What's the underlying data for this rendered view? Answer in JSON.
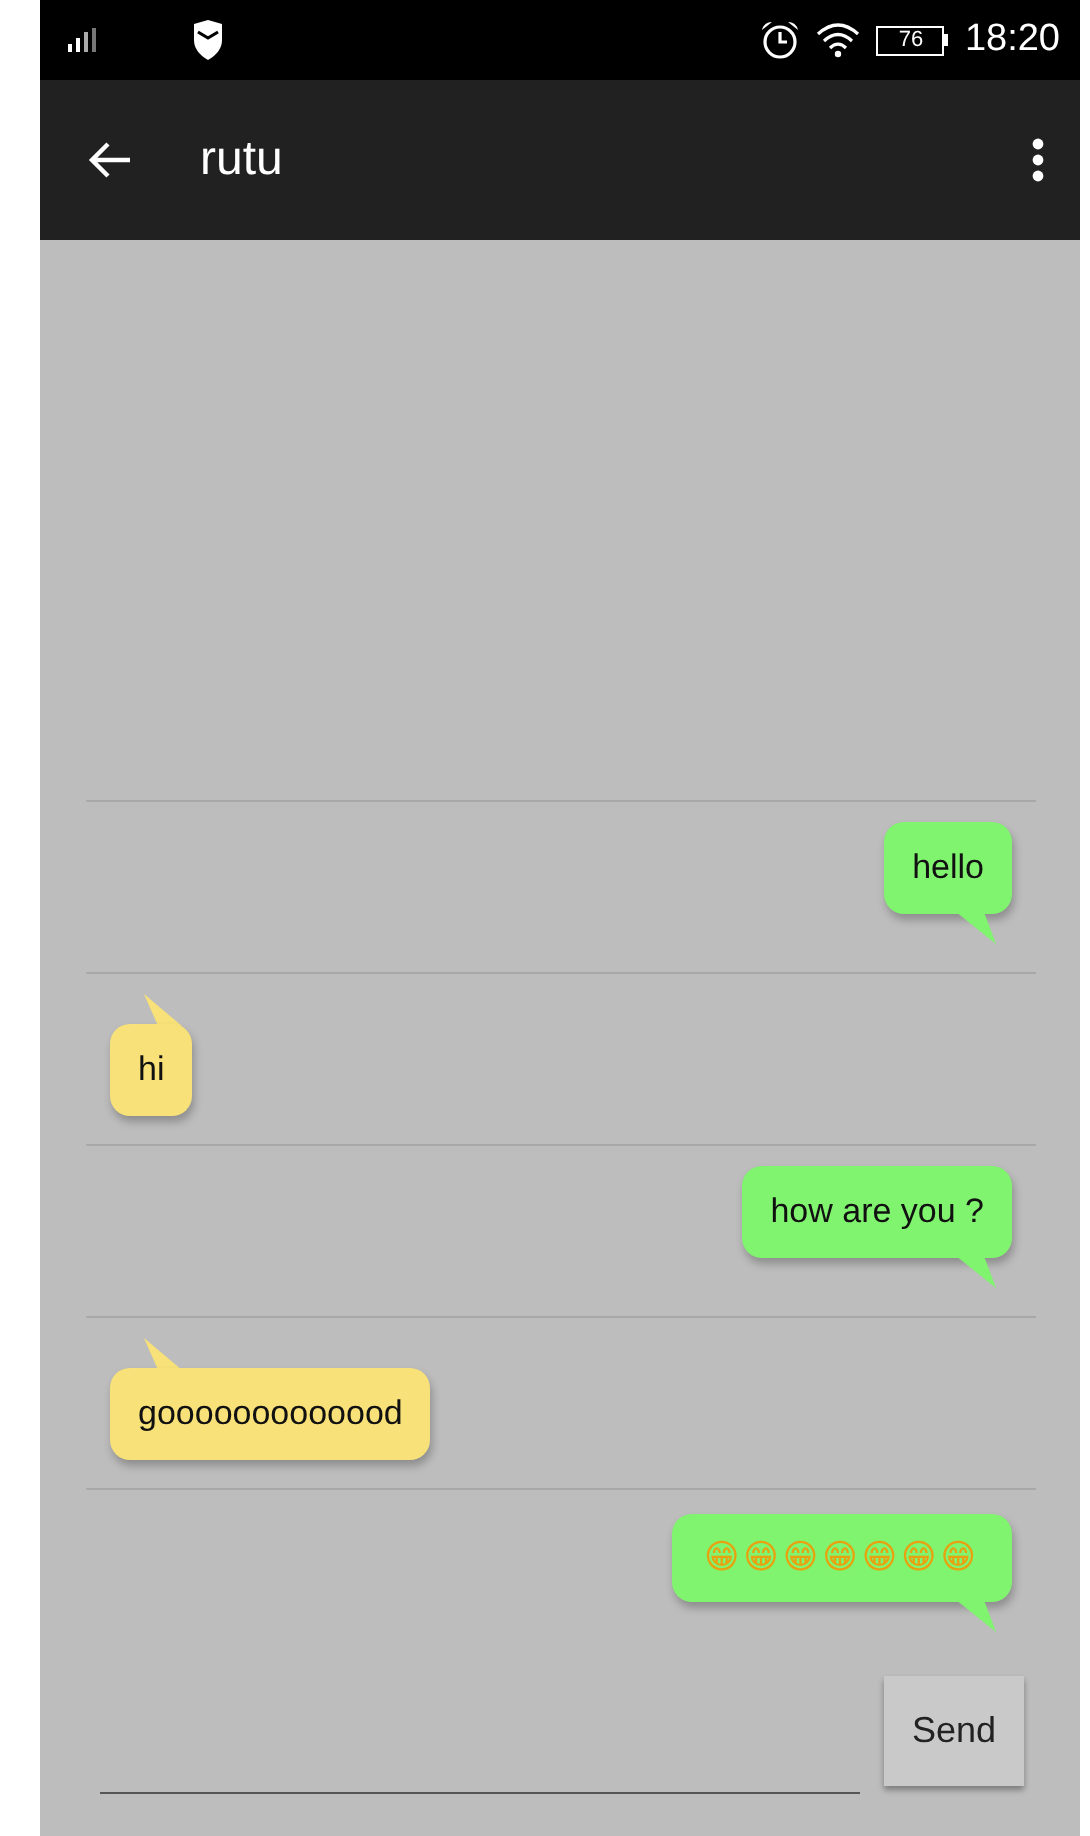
{
  "status_bar": {
    "battery": "76",
    "time": "18:20"
  },
  "toolbar": {
    "title": "rutu"
  },
  "messages": [
    {
      "outgoing": true,
      "kind": "text",
      "text": "hello"
    },
    {
      "outgoing": false,
      "kind": "text",
      "text": "hi"
    },
    {
      "outgoing": true,
      "kind": "text",
      "text": "how are you ?"
    },
    {
      "outgoing": false,
      "kind": "text",
      "text": "gooooooooooood"
    },
    {
      "outgoing": true,
      "kind": "emoji",
      "text": "😁😁😁😁😁😁😁"
    }
  ],
  "composer": {
    "button": "Send"
  }
}
